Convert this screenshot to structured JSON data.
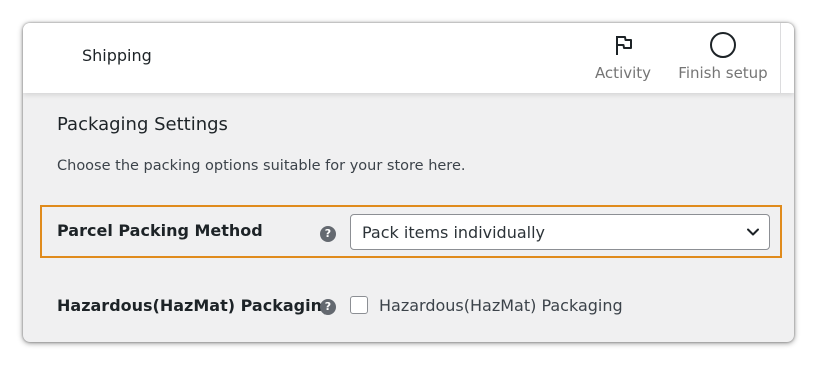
{
  "header": {
    "title": "Shipping",
    "actions": [
      {
        "label": "Activity",
        "icon": "flag-icon"
      },
      {
        "label": "Finish setup",
        "icon": "circle-progress-icon"
      }
    ]
  },
  "section": {
    "title": "Packaging Settings",
    "description": "Choose the packing options suitable for your store here."
  },
  "fields": {
    "packing_method": {
      "label": "Parcel Packing Method",
      "help_icon": "help-icon",
      "value": "Pack items individually"
    },
    "hazmat": {
      "label": "Hazardous(HazMat) Packaging",
      "help_icon": "help-icon",
      "checkbox_label": "Hazardous(HazMat) Packaging",
      "checked": false
    }
  },
  "colors": {
    "highlight_border": "#e08b1c",
    "page_background": "#f0f0f1",
    "header_background": "#ffffff",
    "help_icon": "#646970"
  }
}
